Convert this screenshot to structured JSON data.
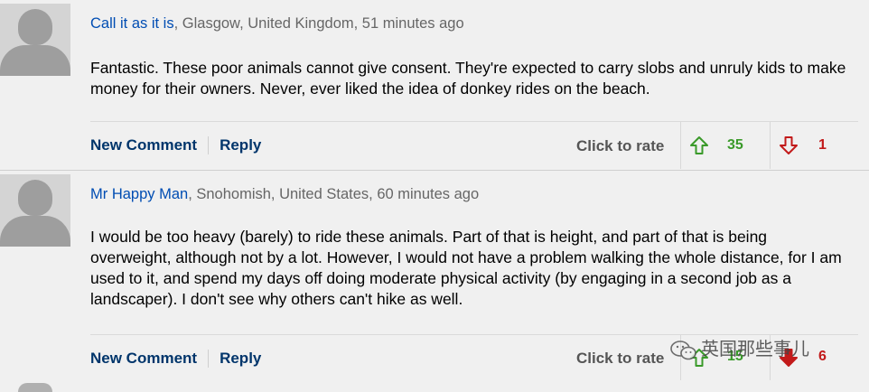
{
  "comments": [
    {
      "author": "Call it as it is",
      "location": ", Glasgow, United Kingdom, 51 minutes ago",
      "text": "Fantastic. These poor animals cannot give consent. They're expected to carry slobs and unruly kids to make money for their owners. Never, ever liked the idea of donkey rides on the beach.",
      "new_comment": "New Comment",
      "reply": "Reply",
      "rate_label": "Click to rate",
      "up": "35",
      "down": "1"
    },
    {
      "author": "Mr Happy Man",
      "location": ", Snohomish, United States, 60 minutes ago",
      "text": "I would be too heavy (barely) to ride these animals. Part of that is height, and part of that is being overweight, although not by a lot. However, I would not have a problem walking the whole distance, for I am used to it, and spend my days off doing moderate physical activity (by engaging in a second job as a landscaper). I don't see why others can't hike as well.",
      "new_comment": "New Comment",
      "reply": "Reply",
      "rate_label": "Click to rate",
      "up": "15",
      "down": "6"
    }
  ],
  "watermark": "英国那些事儿",
  "colors": {
    "author": "#004db3",
    "action": "#00356b",
    "up": "#3a9a2a",
    "down": "#c21a1a"
  },
  "icons": {
    "avatar": "default-avatar-icon",
    "up": "thumb-up-arrow-icon",
    "down": "thumb-down-arrow-icon",
    "watermark": "wechat-icon"
  }
}
